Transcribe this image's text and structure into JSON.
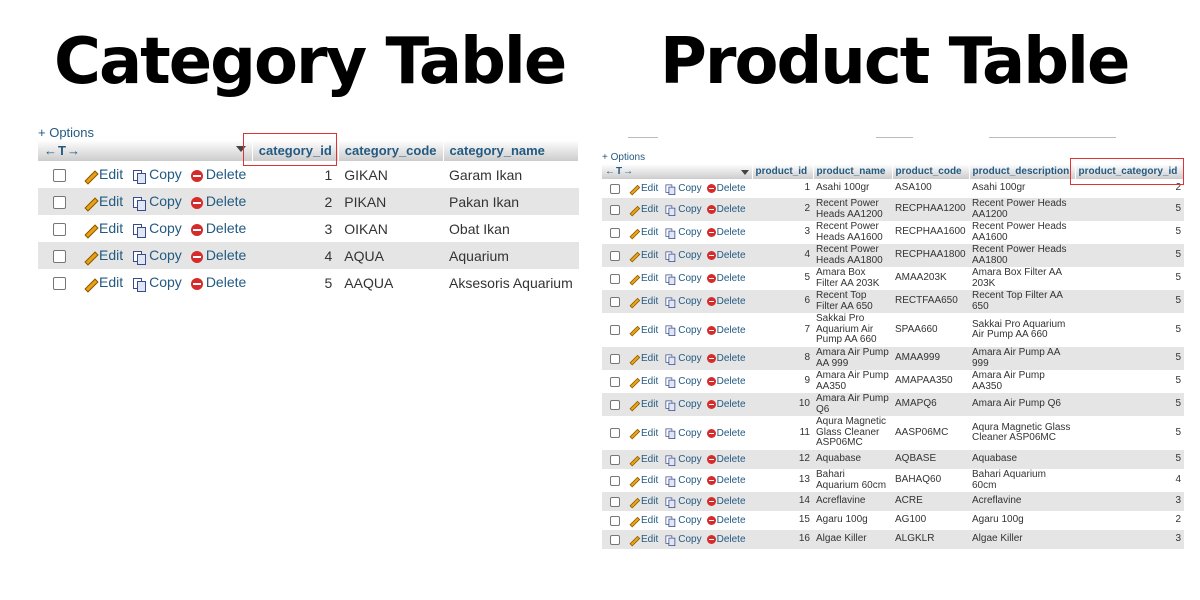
{
  "titles": {
    "category": "Category Table",
    "product": "Product Table"
  },
  "category": {
    "options_label": "+ Options",
    "nav_arrows": "←T→",
    "columns": [
      "category_id",
      "category_code",
      "category_name"
    ],
    "actions": {
      "edit": "Edit",
      "copy": "Copy",
      "delete": "Delete"
    },
    "rows": [
      {
        "id": "1",
        "code": "GIKAN",
        "name": "Garam Ikan"
      },
      {
        "id": "2",
        "code": "PIKAN",
        "name": "Pakan Ikan"
      },
      {
        "id": "3",
        "code": "OIKAN",
        "name": "Obat Ikan"
      },
      {
        "id": "4",
        "code": "AQUA",
        "name": "Aquarium"
      },
      {
        "id": "5",
        "code": "AAQUA",
        "name": "Aksesoris Aquarium"
      }
    ],
    "highlighted_column": "category_id"
  },
  "product": {
    "options_label": "+ Options",
    "nav_arrows": "←T→",
    "columns": [
      "product_id",
      "product_name",
      "product_code",
      "product_description",
      "product_category_id"
    ],
    "actions": {
      "edit": "Edit",
      "copy": "Copy",
      "delete": "Delete"
    },
    "rows": [
      {
        "id": "1",
        "name": "Asahi 100gr",
        "code": "ASA100",
        "desc": "Asahi 100gr",
        "cat": "2"
      },
      {
        "id": "2",
        "name": "Recent Power Heads AA1200",
        "code": "RECPHAA1200",
        "desc": "Recent Power Heads AA1200",
        "cat": "5"
      },
      {
        "id": "3",
        "name": "Recent Power Heads AA1600",
        "code": "RECPHAA1600",
        "desc": "Recent Power Heads AA1600",
        "cat": "5"
      },
      {
        "id": "4",
        "name": "Recent Power Heads AA1800",
        "code": "RECPHAA1800",
        "desc": "Recent Power Heads AA1800",
        "cat": "5"
      },
      {
        "id": "5",
        "name": "Amara Box Filter AA 203K",
        "code": "AMAA203K",
        "desc": "Amara Box Filter AA 203K",
        "cat": "5"
      },
      {
        "id": "6",
        "name": "Recent Top Filter AA 650",
        "code": "RECTFAA650",
        "desc": "Recent Top Filter AA 650",
        "cat": "5"
      },
      {
        "id": "7",
        "name": "Sakkai Pro Aquarium Air Pump AA 660",
        "code": "SPAA660",
        "desc": "Sakkai Pro Aquarium Air Pump AA 660",
        "cat": "5"
      },
      {
        "id": "8",
        "name": "Amara Air Pump AA 999",
        "code": "AMAA999",
        "desc": "Amara Air Pump AA 999",
        "cat": "5"
      },
      {
        "id": "9",
        "name": "Amara Air Pump AA350",
        "code": "AMAPAA350",
        "desc": "Amara Air Pump AA350",
        "cat": "5"
      },
      {
        "id": "10",
        "name": "Amara Air Pump Q6",
        "code": "AMAPQ6",
        "desc": "Amara Air Pump Q6",
        "cat": "5"
      },
      {
        "id": "11",
        "name": "Aqura Magnetic Glass Cleaner ASP06MC",
        "code": "AASP06MC",
        "desc": "Aqura Magnetic Glass Cleaner ASP06MC",
        "cat": "5"
      },
      {
        "id": "12",
        "name": "Aquabase",
        "code": "AQBASE",
        "desc": "Aquabase",
        "cat": "5"
      },
      {
        "id": "13",
        "name": "Bahari Aquarium 60cm",
        "code": "BAHAQ60",
        "desc": "Bahari Aquarium 60cm",
        "cat": "4"
      },
      {
        "id": "14",
        "name": "Acreflavine",
        "code": "ACRE",
        "desc": "Acreflavine",
        "cat": "3"
      },
      {
        "id": "15",
        "name": "Agaru 100g",
        "code": "AG100",
        "desc": "Agaru 100g",
        "cat": "2"
      },
      {
        "id": "16",
        "name": "Algae Killer",
        "code": "ALGKLR",
        "desc": "Algae Killer",
        "cat": "3"
      }
    ],
    "highlighted_column": "product_category_id"
  }
}
